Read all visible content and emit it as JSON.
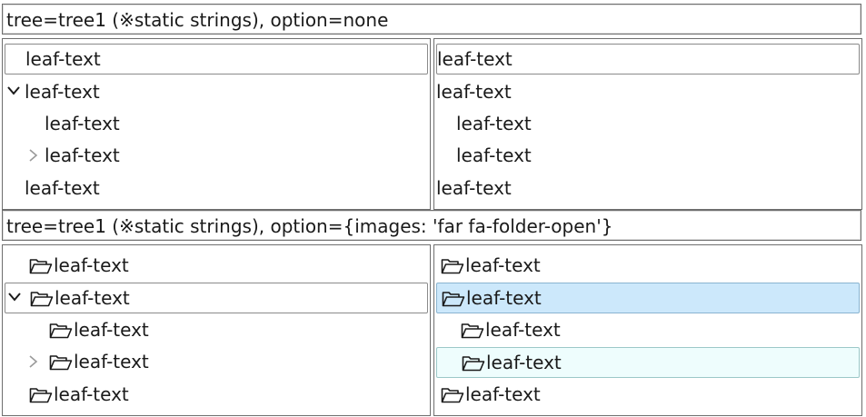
{
  "sections": [
    {
      "header": "tree=tree1 (※static strings), option=none",
      "left_tree": [
        "leaf-text",
        "leaf-text",
        "leaf-text",
        "leaf-text",
        "leaf-text"
      ],
      "right_tree": [
        "leaf-text",
        "leaf-text",
        "leaf-text",
        "leaf-text",
        "leaf-text"
      ]
    },
    {
      "header": "tree=tree1 (※static strings), option={images: 'far fa-folder-open'}",
      "left_tree": [
        "leaf-text",
        "leaf-text",
        "leaf-text",
        "leaf-text",
        "leaf-text"
      ],
      "right_tree": [
        "leaf-text",
        "leaf-text",
        "leaf-text",
        "leaf-text",
        "leaf-text"
      ]
    }
  ],
  "icons": {
    "expanded": "chevron-down-icon",
    "collapsed": "chevron-right-icon",
    "folder": "folder-open-icon"
  },
  "colors": {
    "selected_bg": "#cce8fb",
    "hover_bg": "#eefdfd",
    "border": "#6e6e6e"
  }
}
